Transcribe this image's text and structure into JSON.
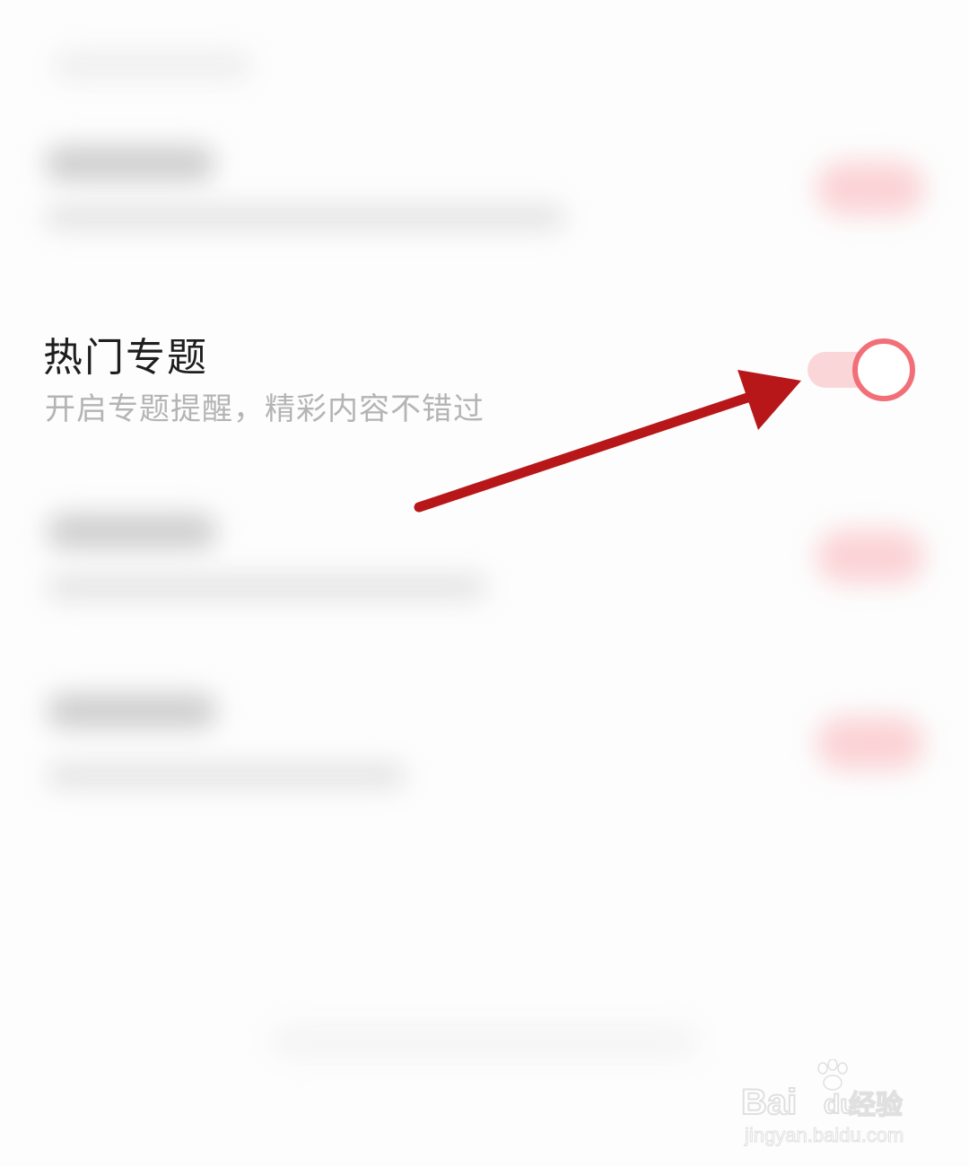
{
  "setting": {
    "title": "热门专题",
    "subtitle": "开启专题提醒，精彩内容不错过",
    "toggle_state": "on"
  },
  "watermark": {
    "brand": "Bai",
    "brand_suffix": "du",
    "product": "经验",
    "url": "jingyan.baidu.com"
  },
  "colors": {
    "toggle_track": "#fad6d8",
    "toggle_knob_border": "#f26f78",
    "annotation_arrow": "#b8171a",
    "subtitle_text": "#b4b4b4"
  },
  "icons": {
    "annotation": "arrow-annotation-icon",
    "watermark_paw": "baidu-paw-icon"
  }
}
